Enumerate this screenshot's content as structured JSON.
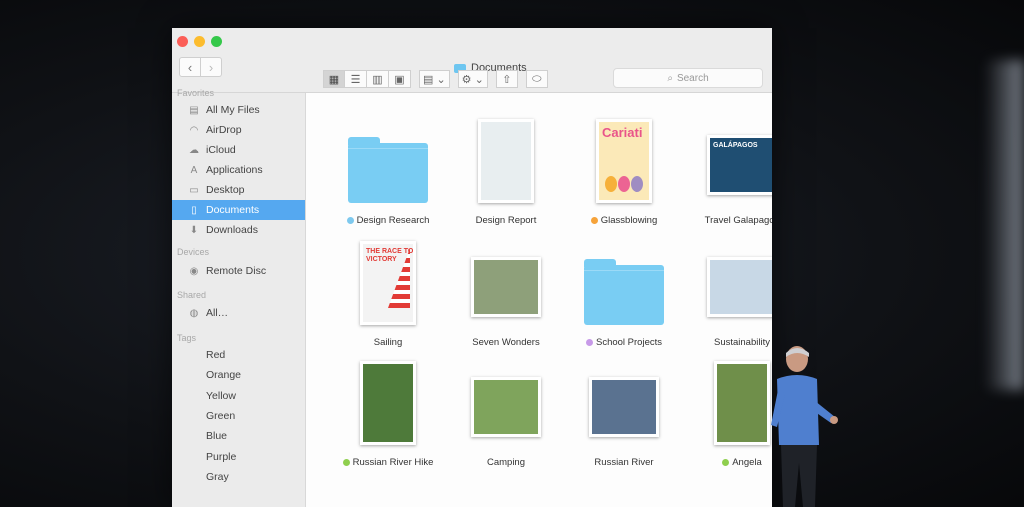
{
  "window": {
    "title": "Documents",
    "nav": {
      "back": "‹",
      "forward": "›"
    },
    "search_placeholder": "Search"
  },
  "toolbar": {
    "view_icons": [
      "icon-view-icon",
      "list-view-icon",
      "column-view-icon",
      "coverflow-view-icon"
    ],
    "group_icon": "group-by-icon",
    "action_icon": "gear-icon",
    "share_icon": "share-icon",
    "tag_icon": "tag-icon"
  },
  "sidebar": {
    "favorites_title": "Favorites",
    "favorites": [
      {
        "label": "All My Files",
        "icon": "all-files-icon",
        "glyph": "▤"
      },
      {
        "label": "AirDrop",
        "icon": "airdrop-icon",
        "glyph": "◠"
      },
      {
        "label": "iCloud",
        "icon": "cloud-icon",
        "glyph": "☁"
      },
      {
        "label": "Applications",
        "icon": "applications-icon",
        "glyph": "A"
      },
      {
        "label": "Desktop",
        "icon": "desktop-icon",
        "glyph": "▭"
      },
      {
        "label": "Documents",
        "icon": "documents-icon",
        "glyph": "▯",
        "selected": true
      },
      {
        "label": "Downloads",
        "icon": "downloads-icon",
        "glyph": "⬇"
      }
    ],
    "devices_title": "Devices",
    "devices": [
      {
        "label": "Remote Disc",
        "icon": "disc-icon",
        "glyph": "◉"
      }
    ],
    "shared_title": "Shared",
    "shared": [
      {
        "label": "All…",
        "icon": "network-icon",
        "glyph": "◍"
      }
    ],
    "tags_title": "Tags",
    "tags": [
      {
        "label": "Red",
        "color": "#f26c6a"
      },
      {
        "label": "Orange",
        "color": "#f6a33a"
      },
      {
        "label": "Yellow",
        "color": "#e6d43a"
      },
      {
        "label": "Green",
        "color": "#8fcf4e"
      },
      {
        "label": "Blue",
        "color": "#7ec9ee"
      },
      {
        "label": "Purple",
        "color": "#c79ae8"
      },
      {
        "label": "Gray",
        "color": "#b5b5b5"
      }
    ]
  },
  "files": [
    {
      "name": "Design Research",
      "kind": "folder",
      "tag": "#7ec9ee"
    },
    {
      "name": "Design Report",
      "kind": "document",
      "tag": ""
    },
    {
      "name": "Glassblowing",
      "kind": "document",
      "tag": "#f6a33a",
      "cover_text": "Cariati"
    },
    {
      "name": "Travel Galapagos",
      "kind": "document",
      "tag": "",
      "cover_text": "GALÁPAGOS"
    },
    {
      "name": "Sailing",
      "kind": "document",
      "tag": "",
      "cover_text": "THE RACE TO VICTORY"
    },
    {
      "name": "Seven Wonders",
      "kind": "document",
      "tag": ""
    },
    {
      "name": "School Projects",
      "kind": "folder",
      "tag": "#c79ae8"
    },
    {
      "name": "Sustainability",
      "kind": "document",
      "tag": ""
    },
    {
      "name": "Russian River Hike",
      "kind": "photo",
      "tag": "#8fcf4e"
    },
    {
      "name": "Camping",
      "kind": "photo",
      "tag": ""
    },
    {
      "name": "Russian River",
      "kind": "photo",
      "tag": ""
    },
    {
      "name": "Angela",
      "kind": "photo",
      "tag": "#8fcf4e"
    }
  ]
}
